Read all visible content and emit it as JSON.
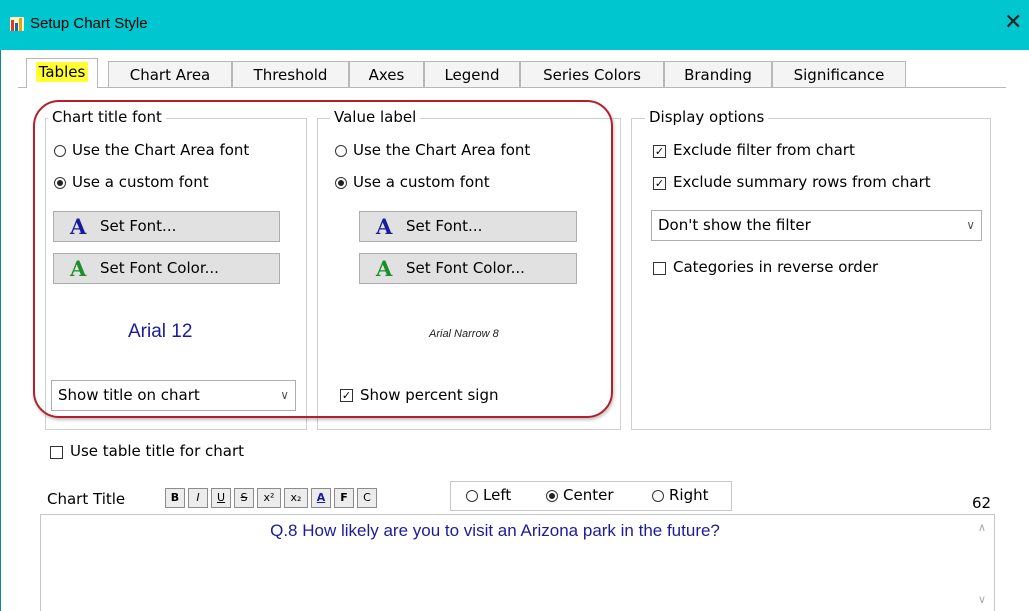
{
  "window": {
    "title": "Setup Chart Style",
    "close_glyph": "✕"
  },
  "tabs": [
    {
      "label": "Tables",
      "active": true
    },
    {
      "label": "Chart Area",
      "active": false
    },
    {
      "label": "Threshold",
      "active": false
    },
    {
      "label": "Axes",
      "active": false
    },
    {
      "label": "Legend",
      "active": false
    },
    {
      "label": "Series Colors",
      "active": false
    },
    {
      "label": "Branding",
      "active": false
    },
    {
      "label": "Significance",
      "active": false
    }
  ],
  "chart_title_font": {
    "legend": "Chart title font",
    "option_chart_area": "Use the Chart Area font",
    "option_custom": "Use a custom font",
    "set_font": "Set Font...",
    "set_font_color": "Set Font Color...",
    "preview": "Arial 12",
    "dropdown_value": "Show title on chart"
  },
  "value_label": {
    "legend": "Value label",
    "option_chart_area": "Use the Chart Area font",
    "option_custom": "Use a custom font",
    "set_font": "Set Font...",
    "set_font_color": "Set Font Color...",
    "preview": "Arial Narrow 8",
    "show_percent": "Show percent sign",
    "show_percent_checked": true
  },
  "display_options": {
    "legend": "Display options",
    "exclude_filter": "Exclude filter from chart",
    "exclude_filter_checked": true,
    "exclude_summary": "Exclude summary rows from chart",
    "exclude_summary_checked": true,
    "filter_dropdown": "Don't show the filter",
    "reverse_order": "Categories in reverse order",
    "reverse_order_checked": false
  },
  "use_table_title": {
    "label": "Use table title for chart",
    "checked": false
  },
  "chart_title": {
    "label": "Chart Title",
    "toolbar": [
      "B",
      "I",
      "U",
      "S",
      "x²",
      "x₂",
      "A",
      "F",
      "C"
    ],
    "align_left": "Left",
    "align_center": "Center",
    "align_right": "Right",
    "selected_align": "Center",
    "char_count": "62",
    "text": "Q.8 How likely are you to visit an Arizona park in the future?"
  },
  "colors": {
    "titlebar": "#00c7cf",
    "highlight": "#b41f2c",
    "tab_highlight": "#ffff33",
    "title_text": "#1c1c9a"
  }
}
